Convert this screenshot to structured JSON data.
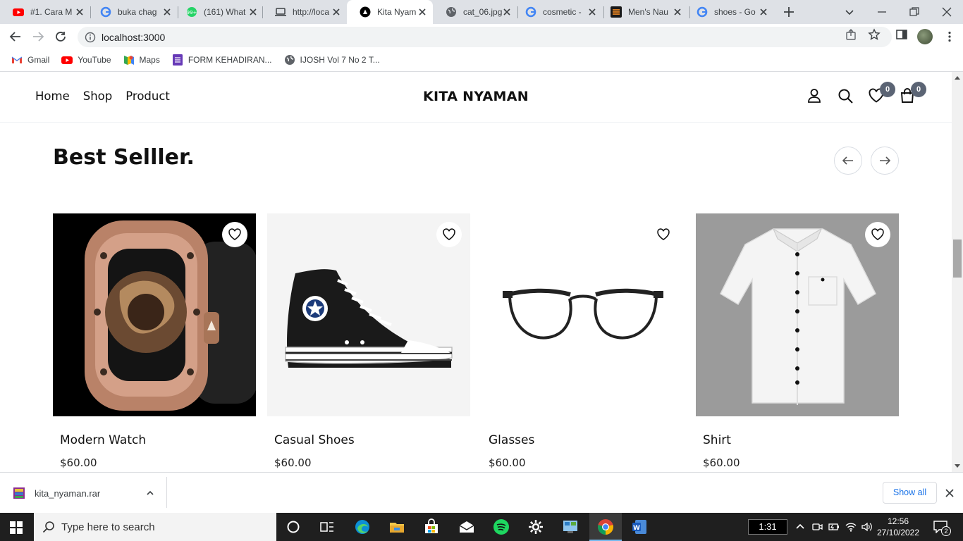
{
  "browser": {
    "tabs": [
      {
        "label": "#1. Cara M",
        "icon": "youtube-icon"
      },
      {
        "label": "buka chag",
        "icon": "google-icon"
      },
      {
        "label": "(161) What",
        "icon": "whatsapp-icon"
      },
      {
        "label": "http://loca",
        "icon": "laptop-icon"
      },
      {
        "label": "Kita Nyam",
        "icon": "nextjs-icon",
        "active": true
      },
      {
        "label": "cat_06.jpg",
        "icon": "globe-icon"
      },
      {
        "label": "cosmetic -",
        "icon": "google-icon"
      },
      {
        "label": "Men's Nau",
        "icon": "site-icon"
      },
      {
        "label": "shoes - Go",
        "icon": "google-icon"
      }
    ],
    "url": "localhost:3000",
    "bookmarks": [
      {
        "label": "Gmail",
        "icon": "gmail-icon"
      },
      {
        "label": "YouTube",
        "icon": "youtube-icon"
      },
      {
        "label": "Maps",
        "icon": "maps-icon"
      },
      {
        "label": "FORM KEHADIRAN...",
        "icon": "forms-icon"
      },
      {
        "label": "IJOSH Vol 7 No 2 T...",
        "icon": "globe-icon"
      }
    ]
  },
  "site": {
    "nav": [
      "Home",
      "Shop",
      "Product"
    ],
    "brand": "KITA NYAMAN",
    "wishlist_count": "0",
    "cart_count": "0",
    "section_title": "Best Selller.",
    "products": [
      {
        "name": "Modern Watch",
        "price": "$60.00"
      },
      {
        "name": "Casual Shoes",
        "price": "$60.00"
      },
      {
        "name": "Glasses",
        "price": "$60.00"
      },
      {
        "name": "Shirt",
        "price": "$60.00"
      }
    ]
  },
  "downloads": {
    "file": "kita_nyaman.rar",
    "show_all": "Show all"
  },
  "taskbar": {
    "search_placeholder": "Type here to search",
    "timer": "1:31",
    "time": "12:56",
    "date": "27/10/2022",
    "notifications": "2"
  },
  "colors": {
    "badge": "#5b6474",
    "chrome_tabstrip": "#dee1e6",
    "link_blue": "#1a73e8"
  }
}
